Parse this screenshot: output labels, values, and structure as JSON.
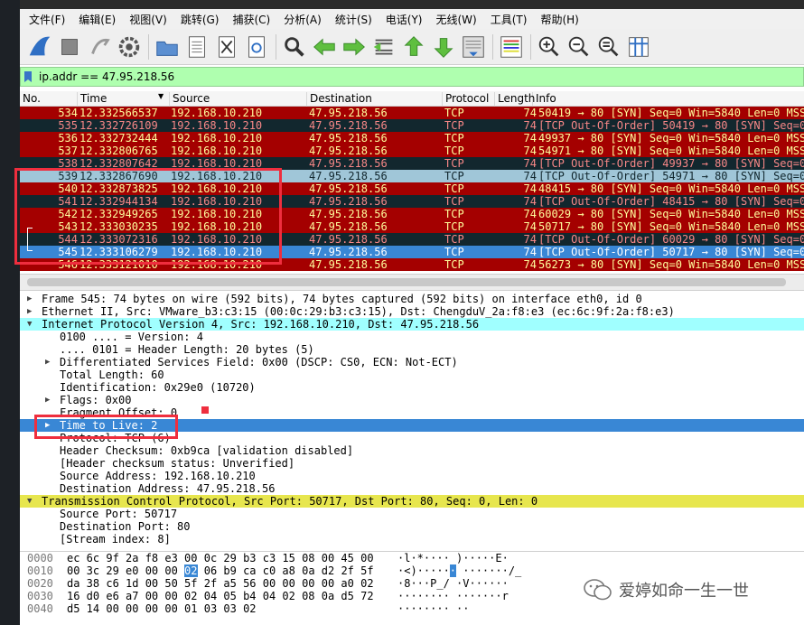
{
  "menu": [
    "文件(F)",
    "编辑(E)",
    "视图(V)",
    "跳转(G)",
    "捕获(C)",
    "分析(A)",
    "统计(S)",
    "电话(Y)",
    "无线(W)",
    "工具(T)",
    "帮助(H)"
  ],
  "toolbar": [
    "shark-fin-start-icon",
    "stop-square-icon",
    "restart-icon",
    "capture-options-gear-icon",
    "open-folder-icon",
    "save-file-icon",
    "close-file-icon",
    "reload-icon",
    "find-magnifier-icon",
    "go-back-arrow-icon",
    "go-forward-arrow-icon",
    "go-to-packet-icon",
    "go-first-icon",
    "go-last-icon",
    "autoscroll-icon",
    "colorize-icon",
    "zoom-in-icon",
    "zoom-out-icon",
    "zoom-normal-icon",
    "resize-columns-icon"
  ],
  "filter": {
    "value": "ip.addr == 47.95.218.56"
  },
  "columns": {
    "no": "No.",
    "time": "Time",
    "source": "Source",
    "destination": "Destination",
    "protocol": "Protocol",
    "length": "Length",
    "info": "Info"
  },
  "colors": {
    "bad": "#a40000",
    "dark": "#12272e",
    "selected": "#3987d5",
    "light": "#a0c6d8",
    "ipv4": "#a0ffff",
    "tcp": "#e7e64e",
    "redbox": "#ef2e3e"
  },
  "packets": [
    {
      "no": "534",
      "time": "12.332566537",
      "src": "192.168.10.210",
      "dst": "47.95.218.56",
      "proto": "TCP",
      "len": "74",
      "info": "50419 → 80 [SYN] Seq=0 Win=5840 Len=0 MSS=",
      "style": "bad"
    },
    {
      "no": "535",
      "time": "12.332726109",
      "src": "192.168.10.210",
      "dst": "47.95.218.56",
      "proto": "TCP",
      "len": "74",
      "info": "[TCP Out-Of-Order] 50419 → 80 [SYN] Seq=0",
      "style": "dark"
    },
    {
      "no": "536",
      "time": "12.332732444",
      "src": "192.168.10.210",
      "dst": "47.95.218.56",
      "proto": "TCP",
      "len": "74",
      "info": "49937 → 80 [SYN] Seq=0 Win=5840 Len=0 MSS=",
      "style": "bad"
    },
    {
      "no": "537",
      "time": "12.332806765",
      "src": "192.168.10.210",
      "dst": "47.95.218.56",
      "proto": "TCP",
      "len": "74",
      "info": "54971 → 80 [SYN] Seq=0 Win=5840 Len=0 MSS=",
      "style": "bad"
    },
    {
      "no": "538",
      "time": "12.332807642",
      "src": "192.168.10.210",
      "dst": "47.95.218.56",
      "proto": "TCP",
      "len": "74",
      "info": "[TCP Out-Of-Order] 49937 → 80 [SYN] Seq=0",
      "style": "dark"
    },
    {
      "no": "539",
      "time": "12.332867690",
      "src": "192.168.10.210",
      "dst": "47.95.218.56",
      "proto": "TCP",
      "len": "74",
      "info": "[TCP Out-Of-Order] 54971 → 80 [SYN] Seq=0",
      "style": "light"
    },
    {
      "no": "540",
      "time": "12.332873825",
      "src": "192.168.10.210",
      "dst": "47.95.218.56",
      "proto": "TCP",
      "len": "74",
      "info": "48415 → 80 [SYN] Seq=0 Win=5840 Len=0 MSS=",
      "style": "bad"
    },
    {
      "no": "541",
      "time": "12.332944134",
      "src": "192.168.10.210",
      "dst": "47.95.218.56",
      "proto": "TCP",
      "len": "74",
      "info": "[TCP Out-Of-Order] 48415 → 80 [SYN] Seq=0",
      "style": "dark"
    },
    {
      "no": "542",
      "time": "12.332949265",
      "src": "192.168.10.210",
      "dst": "47.95.218.56",
      "proto": "TCP",
      "len": "74",
      "info": "60029 → 80 [SYN] Seq=0 Win=5840 Len=0 MSS=",
      "style": "bad"
    },
    {
      "no": "543",
      "time": "12.333030235",
      "src": "192.168.10.210",
      "dst": "47.95.218.56",
      "proto": "TCP",
      "len": "74",
      "info": "50717 → 80 [SYN] Seq=0 Win=5840 Len=0 MSS=",
      "style": "bad"
    },
    {
      "no": "544",
      "time": "12.333072316",
      "src": "192.168.10.210",
      "dst": "47.95.218.56",
      "proto": "TCP",
      "len": "74",
      "info": "[TCP Out-Of-Order] 60029 → 80 [SYN] Seq=0",
      "style": "dark"
    },
    {
      "no": "545",
      "time": "12.333106279",
      "src": "192.168.10.210",
      "dst": "47.95.218.56",
      "proto": "TCP",
      "len": "74",
      "info": "[TCP Out-Of-Order] 50717 → 80 [SYN] Seq=0",
      "style": "selected"
    },
    {
      "no": "546",
      "time": "12.333121010",
      "src": "192.168.10.210",
      "dst": "47.95.218.56",
      "proto": "TCP",
      "len": "74",
      "info": "56273 → 80 [SYN] Seq=0 Win=5840 Len=0 MSS=",
      "style": "bad"
    }
  ],
  "details": [
    {
      "text": "Frame 545: 74 bytes on wire (592 bits), 74 bytes captured (592 bits) on interface eth0, id 0",
      "level": 0,
      "arrow": "right",
      "style": "plain"
    },
    {
      "text": "Ethernet II, Src: VMware_b3:c3:15 (00:0c:29:b3:c3:15), Dst: ChengduV_2a:f8:e3 (ec:6c:9f:2a:f8:e3)",
      "level": 0,
      "arrow": "right",
      "style": "plain"
    },
    {
      "text": "Internet Protocol Version 4, Src: 192.168.10.210, Dst: 47.95.218.56",
      "level": 0,
      "arrow": "down",
      "style": "ipv4"
    },
    {
      "text": "0100 .... = Version: 4",
      "level": 1,
      "arrow": "",
      "style": "plain"
    },
    {
      "text": ".... 0101 = Header Length: 20 bytes (5)",
      "level": 1,
      "arrow": "",
      "style": "plain"
    },
    {
      "text": "Differentiated Services Field: 0x00 (DSCP: CS0, ECN: Not-ECT)",
      "level": 1,
      "arrow": "right",
      "style": "plain"
    },
    {
      "text": "Total Length: 60",
      "level": 1,
      "arrow": "",
      "style": "plain"
    },
    {
      "text": "Identification: 0x29e0 (10720)",
      "level": 1,
      "arrow": "",
      "style": "plain"
    },
    {
      "text": "Flags: 0x00",
      "level": 1,
      "arrow": "right",
      "style": "plain"
    },
    {
      "text": "Fragment Offset: 0",
      "level": 1,
      "arrow": "",
      "style": "plain"
    },
    {
      "text": "Time to Live: 2",
      "level": 1,
      "arrow": "right",
      "style": "selected"
    },
    {
      "text": "Protocol: TCP (6)",
      "level": 1,
      "arrow": "",
      "style": "plain"
    },
    {
      "text": "Header Checksum: 0xb9ca [validation disabled]",
      "level": 1,
      "arrow": "",
      "style": "plain"
    },
    {
      "text": "[Header checksum status: Unverified]",
      "level": 1,
      "arrow": "",
      "style": "plain"
    },
    {
      "text": "Source Address: 192.168.10.210",
      "level": 1,
      "arrow": "",
      "style": "plain"
    },
    {
      "text": "Destination Address: 47.95.218.56",
      "level": 1,
      "arrow": "",
      "style": "plain"
    },
    {
      "text": "Transmission Control Protocol, Src Port: 50717, Dst Port: 80, Seq: 0, Len: 0",
      "level": 0,
      "arrow": "down",
      "style": "tcp"
    },
    {
      "text": "Source Port: 50717",
      "level": 1,
      "arrow": "",
      "style": "plain"
    },
    {
      "text": "Destination Port: 80",
      "level": 1,
      "arrow": "",
      "style": "plain"
    },
    {
      "text": "[Stream index: 8]",
      "level": 1,
      "arrow": "",
      "style": "plain"
    }
  ],
  "hex": [
    {
      "offset": "0000",
      "bytes": "ec 6c 9f 2a f8 e3 00 0c  29 b3 c3 15 08 00 45 00",
      "ascii": "·l·*····  )·····E·"
    },
    {
      "offset": "0010",
      "pre": "00 3c 29 e0 00 00 ",
      "hl": "02",
      "post": " 06  b9 ca c0 a8 0a d2 2f 5f",
      "apre": "·<)·····",
      "ahl": "·",
      "apost": "  ·······/_"
    },
    {
      "offset": "0020",
      "bytes": "da 38 c6 1d 00 50 5f 2f  a5 56 00 00 00 00 a0 02",
      "ascii": "·8···P_/  ·V······"
    },
    {
      "offset": "0030",
      "bytes": "16 d0 e6 a7 00 00 02 04  05 b4 04 02 08 0a d5 72",
      "ascii": "········  ·······r"
    },
    {
      "offset": "0040",
      "bytes": "d5 14 00 00 00 00 01 03  03 02",
      "ascii": "········  ··"
    }
  ],
  "watermark": "爱婷如命一生一世"
}
